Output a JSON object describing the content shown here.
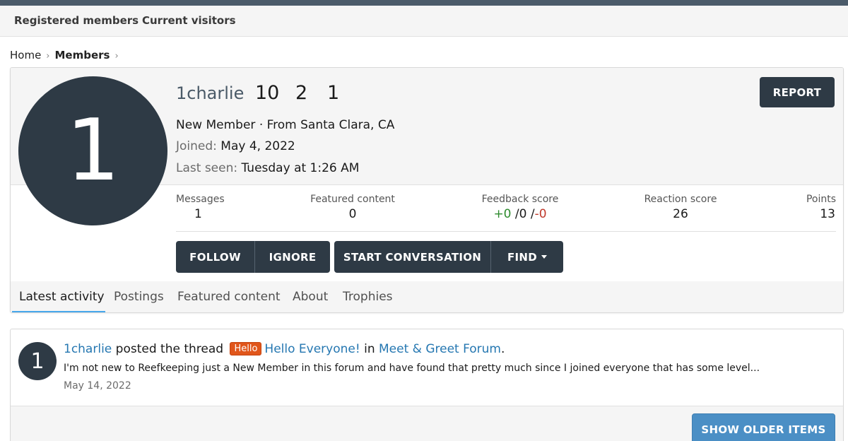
{
  "colors": {
    "dark_button": "#2e3a45",
    "accent_blue": "#47a7eb",
    "link": "#2577b1",
    "positive": "#2e8b2e",
    "negative": "#c0392b",
    "prefix_badge": "#e0561b",
    "older_button": "#4b8fc5"
  },
  "subnav": {
    "items": [
      "Registered members",
      "Current visitors"
    ]
  },
  "breadcrumb": {
    "home": "Home",
    "members": "Members",
    "sep": "›"
  },
  "profile": {
    "avatar_letter": "1",
    "username": "1charlie",
    "counts": [
      "10",
      "2",
      "1"
    ],
    "title_line": "New Member · From Santa Clara, CA",
    "joined_label": "Joined:",
    "joined_value": "May 4, 2022",
    "last_seen_label": "Last seen:",
    "last_seen_value": "Tuesday at 1:26 AM",
    "report_label": "REPORT",
    "stats": {
      "messages": {
        "label": "Messages",
        "value": "1"
      },
      "featured": {
        "label": "Featured content",
        "value": "0"
      },
      "feedback": {
        "label": "Feedback score",
        "positive": "+0",
        "neutral": "0",
        "negative": "-0",
        "sep": "/"
      },
      "reaction": {
        "label": "Reaction score",
        "value": "26"
      },
      "points": {
        "label": "Points",
        "value": "13"
      }
    },
    "buttons": {
      "follow": "FOLLOW",
      "ignore": "IGNORE",
      "start_conversation": "START CONVERSATION",
      "find": "FIND"
    },
    "tabs": [
      "Latest activity",
      "Postings",
      "Featured content",
      "About",
      "Trophies"
    ]
  },
  "activity": {
    "avatar_letter": "1",
    "user": "1charlie",
    "action": "posted the thread",
    "prefix": "Hello",
    "thread": "Hello Everyone!",
    "in": "in",
    "forum": "Meet & Greet Forum",
    "period": ".",
    "snippet": "I'm not new to Reefkeeping just a New Member in this forum and have found that pretty much since I joined everyone that has some level...",
    "date": "May 14, 2022",
    "older_label": "SHOW OLDER ITEMS"
  }
}
